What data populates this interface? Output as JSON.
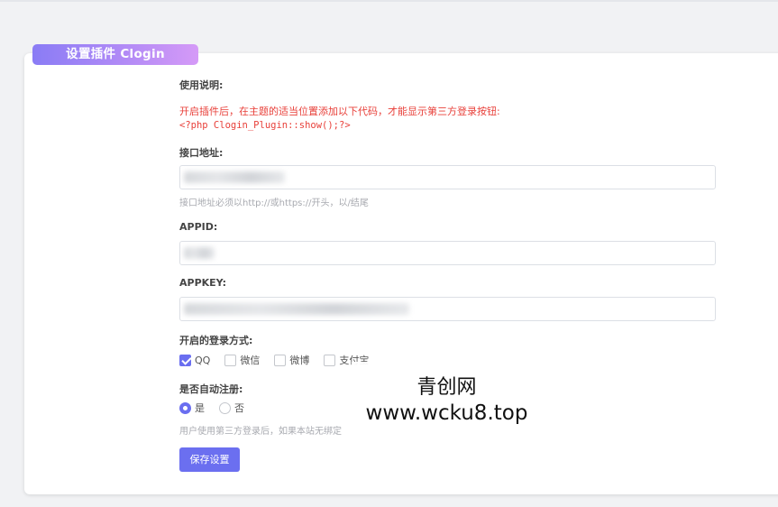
{
  "card": {
    "title": "设置插件 Clogin"
  },
  "usage": {
    "label": "使用说明:",
    "notice": "开启插件后，在主题的适当位置添加以下代码，才能显示第三方登录按钮:",
    "code": "<?php Clogin_Plugin::show();?>"
  },
  "api": {
    "label": "接口地址:",
    "hint": "接口地址必须以http://或https://开头，以/结尾"
  },
  "appid": {
    "label": "APPID:"
  },
  "appkey": {
    "label": "APPKEY:"
  },
  "login_methods": {
    "label": "开启的登录方式:",
    "options": [
      {
        "label": "QQ",
        "checked": true
      },
      {
        "label": "微信",
        "checked": false
      },
      {
        "label": "微博",
        "checked": false
      },
      {
        "label": "支付宝",
        "checked": false
      }
    ]
  },
  "auto_register": {
    "label": "是否自动注册:",
    "options": [
      {
        "label": "是",
        "checked": true
      },
      {
        "label": "否",
        "checked": false
      }
    ],
    "hint": "用户使用第三方登录后，如果本站无绑定"
  },
  "save_label": "保存设置",
  "watermark": {
    "name": "青创网",
    "url": "www.wcku8.top"
  },
  "colors": {
    "accent": "#6b6ff0",
    "notice_red": "#e8403a"
  }
}
